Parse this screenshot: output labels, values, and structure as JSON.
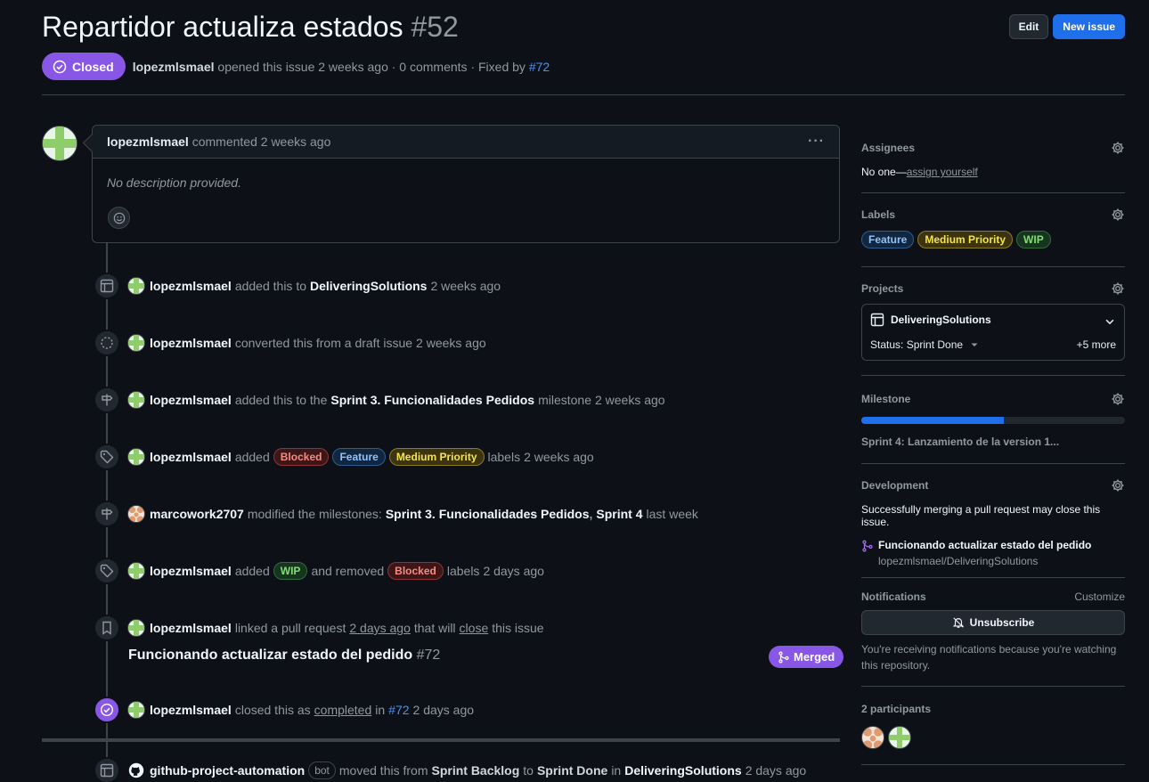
{
  "issue": {
    "title": "Repartidor actualiza estados",
    "number": "#52",
    "state": "Closed",
    "author": "lopezmlsmael",
    "meta_text": "opened this issue 2 weeks ago · 0 comments · Fixed by",
    "fixed_by": "#72"
  },
  "header_buttons": {
    "edit": "Edit",
    "new_issue": "New issue"
  },
  "comment": {
    "author": "lopezmlsmael",
    "action": "commented",
    "time": "2 weeks ago",
    "more": "···",
    "body": "No description provided."
  },
  "timeline": [
    {
      "actor": "lopezmlsmael",
      "pre": "added this to",
      "target": "DeliveringSolutions",
      "time": "2 weeks ago"
    },
    {
      "actor": "lopezmlsmael",
      "pre": "converted this from a draft issue",
      "time": "2 weeks ago"
    },
    {
      "actor": "lopezmlsmael",
      "pre": "added this to the",
      "target": "Sprint 3. Funcionalidades Pedidos",
      "post": "milestone",
      "time": "2 weeks ago"
    },
    {
      "actor": "lopezmlsmael",
      "pre": "added",
      "labels": [
        "Blocked",
        "Feature",
        "Medium Priority"
      ],
      "post": "labels",
      "time": "2 weeks ago"
    },
    {
      "actor": "marcowork2707",
      "pre": "modified the milestones:",
      "target": "Sprint 3. Funcionalidades Pedidos",
      "sep": ",",
      "target2": "Sprint 4",
      "time": "last week"
    },
    {
      "actor": "lopezmlsmael",
      "pre": "added",
      "label_add": "WIP",
      "mid": "and removed",
      "label_remove": "Blocked",
      "post": "labels",
      "time": "2 days ago"
    },
    {
      "actor": "lopezmlsmael",
      "pre": "linked a pull request",
      "time_link": "2 days ago",
      "mid": "that will",
      "close_word": "close",
      "post": "this issue"
    },
    {
      "actor": "lopezmlsmael",
      "pre": "closed this as",
      "completed": "completed",
      "mid": "in",
      "ref": "#72",
      "time": "2 days ago"
    },
    {
      "actor": "github-project-automation",
      "bot": "bot",
      "pre": "moved this from",
      "from": "Sprint Backlog",
      "to_word": "to",
      "to": "Sprint Done",
      "in_word": "in",
      "project": "DeliveringSolutions",
      "time": "2 days ago"
    }
  ],
  "linked_pr": {
    "title": "Funcionando actualizar estado del pedido",
    "number": "#72",
    "status": "Merged"
  },
  "sidebar": {
    "assignees": {
      "heading": "Assignees",
      "value": "No one—",
      "link": "assign yourself"
    },
    "labels": {
      "heading": "Labels",
      "items": [
        "Feature",
        "Medium Priority",
        "WIP"
      ]
    },
    "projects": {
      "heading": "Projects",
      "name": "DeliveringSolutions",
      "status": "Status: Sprint Done",
      "more": "+5 more"
    },
    "milestone": {
      "heading": "Milestone",
      "name": "Sprint 4: Lanzamiento de la version 1...",
      "progress": 0.54
    },
    "development": {
      "heading": "Development",
      "note": "Successfully merging a pull request may close this issue.",
      "pr_title": "Funcionando actualizar estado del pedido",
      "repo": "lopezmlsmael/DeliveringSolutions"
    },
    "notifications": {
      "heading": "Notifications",
      "customize": "Customize",
      "button": "Unsubscribe",
      "note": "You're receiving notifications because you're watching this repository."
    },
    "participants": {
      "heading": "2 participants"
    }
  },
  "colors": {
    "closed_purple": "#8957e5",
    "accent_blue": "#1f6feb",
    "bg": "#0d1117"
  }
}
